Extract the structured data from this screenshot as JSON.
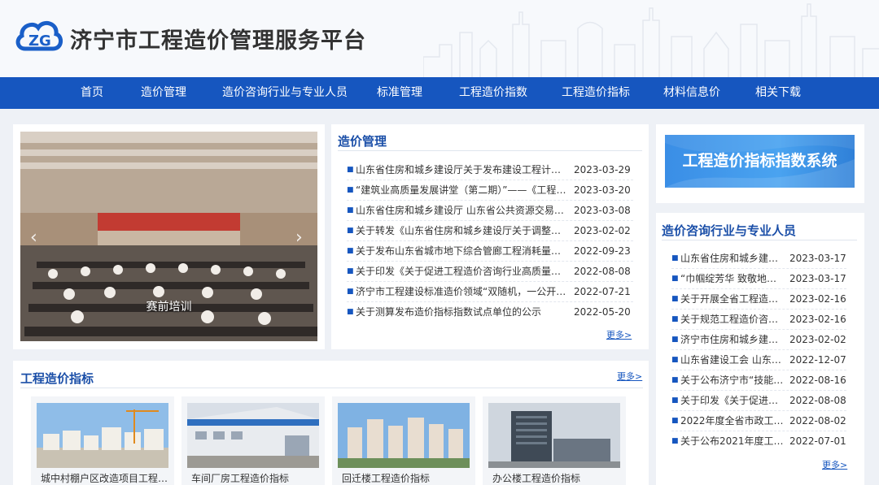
{
  "site": {
    "title": "济宁市工程造价管理服务平台",
    "logo_icon": "cloud-zg-logo-icon"
  },
  "nav": {
    "items": [
      "首页",
      "造价管理",
      "造价咨询行业与专业人员",
      "标准管理",
      "工程造价指数",
      "工程造价指标",
      "材料信息价",
      "相关下载"
    ]
  },
  "slider": {
    "caption": "赛前培训"
  },
  "cost_management": {
    "title": "造价管理",
    "more": "更多>",
    "items": [
      {
        "title": "山东省住房和城乡建设厅关于发布建设工程计价依...",
        "date": "2023-03-29"
      },
      {
        "title": "“建筑业高质量发展讲堂（第二期）”——《工程造...",
        "date": "2023-03-20"
      },
      {
        "title": "山东省住房和城乡建设厅 山东省公共资源交易中心...",
        "date": "2023-03-08"
      },
      {
        "title": "关于转发《山东省住房和城乡建设厅关于调整建设...",
        "date": "2023-02-02"
      },
      {
        "title": "关于发布山东省城市地下综合管廊工程消耗量定额...",
        "date": "2022-09-23"
      },
      {
        "title": "关于印发《关于促进工程造价咨询行业高质量发展...",
        "date": "2022-08-08"
      },
      {
        "title": "济宁市工程建设标准造价领域“双随机，一公开”检...",
        "date": "2022-07-21"
      },
      {
        "title": "关于测算发布造价指标指数试点单位的公示",
        "date": "2022-05-20"
      }
    ]
  },
  "index_banner": {
    "text": "工程造价指标指数系统"
  },
  "consulting": {
    "title": "造价咨询行业与专业人员",
    "more": "更多>",
    "items": [
      {
        "title": "山东省住房和城乡建设...",
        "date": "2023-03-17"
      },
      {
        "title": "“巾帼绽芳华 致敬地力量...",
        "date": "2023-03-17"
      },
      {
        "title": "关于开展全省工程造价...",
        "date": "2023-02-16"
      },
      {
        "title": "关于规范工程造价咨询...",
        "date": "2023-02-16"
      },
      {
        "title": "济宁市住房和城乡建设...",
        "date": "2023-02-02"
      },
      {
        "title": "山东省建设工会 山东省...",
        "date": "2022-12-07"
      },
      {
        "title": "关于公布济宁市“技能状...",
        "date": "2022-08-16"
      },
      {
        "title": "关于印发《关于促进工...",
        "date": "2022-08-08"
      },
      {
        "title": "2022年度全省市政工程...",
        "date": "2022-08-02"
      },
      {
        "title": "关于公布2021年度工程...",
        "date": "2022-07-01"
      }
    ]
  },
  "cost_indicators": {
    "title": "工程造价指标",
    "more": "更多>",
    "cards": [
      {
        "label": "城中村棚户区改造项目工程造..."
      },
      {
        "label": "车间厂房工程造价指标"
      },
      {
        "label": "回迁楼工程造价指标"
      },
      {
        "label": "办公楼工程造价指标"
      }
    ]
  },
  "colors": {
    "nav": "#1656bf",
    "accent": "#1b4fa8",
    "banner": "#3a8ee6"
  }
}
